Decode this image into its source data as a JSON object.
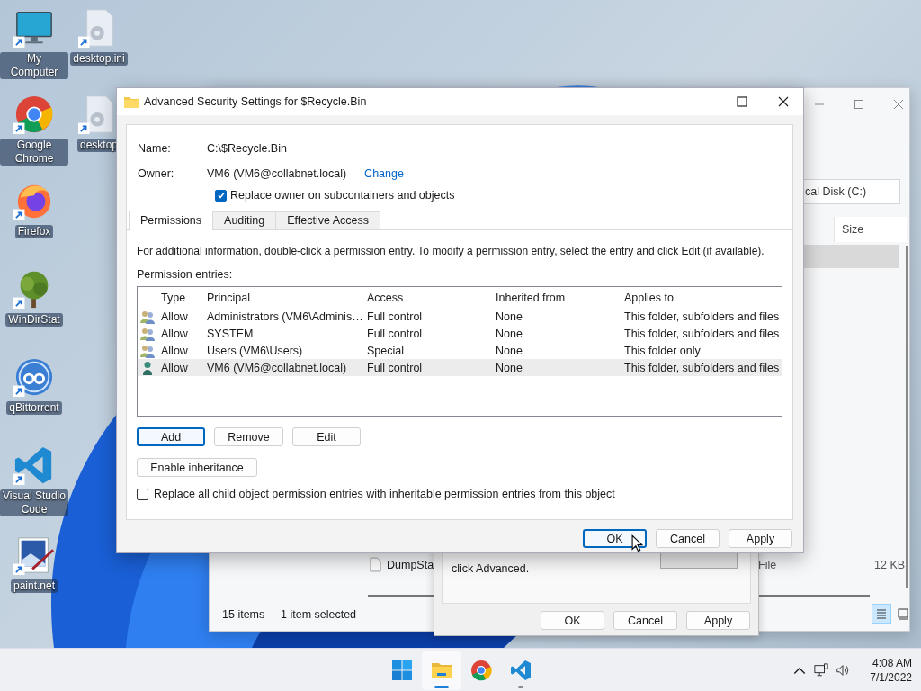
{
  "desktop_icons": [
    {
      "label": "My Computer",
      "kind": "computer"
    },
    {
      "label": "desktop.ini",
      "kind": "settings-file"
    },
    {
      "label": "Google Chrome",
      "kind": "chrome"
    },
    {
      "label": "desktop",
      "kind": "settings-file"
    },
    {
      "label": "Firefox",
      "kind": "firefox"
    },
    {
      "label": "WinDirStat",
      "kind": "tree"
    },
    {
      "label": "qBittorrent",
      "kind": "qb"
    },
    {
      "label": "Visual Studio Code",
      "kind": "vscode"
    },
    {
      "label": "paint.net",
      "kind": "paint"
    }
  ],
  "explorer": {
    "address": "cal Disk (C:)",
    "column": "Size",
    "file": {
      "name": "DumpSta",
      "type": "File",
      "size": "12 KB"
    },
    "status": {
      "items": "15 items",
      "selected": "1 item selected"
    },
    "views": [
      {
        "kind": "details",
        "selected": true
      },
      {
        "kind": "tiles",
        "selected": false
      }
    ]
  },
  "properties": {
    "text": "click Advanced.",
    "buttons": [
      "OK",
      "Cancel",
      "Apply"
    ]
  },
  "dialog": {
    "title": "Advanced Security Settings for $Recycle.Bin",
    "name_label": "Name:",
    "name": "C:\\$Recycle.Bin",
    "owner_label": "Owner:",
    "owner": "VM6 (VM6@collabnet.local)",
    "change_link": "Change",
    "replace_owner": {
      "label": "Replace owner on subcontainers and objects",
      "checked": true
    },
    "tabs": [
      {
        "label": "Permissions",
        "selected": true
      },
      {
        "label": "Auditing",
        "selected": false
      },
      {
        "label": "Effective Access",
        "selected": false
      }
    ],
    "info": "For additional information, double-click a permission entry. To modify a permission entry, select the entry and click Edit (if available).",
    "entries_label": "Permission entries:",
    "columns": [
      "Type",
      "Principal",
      "Access",
      "Inherited from",
      "Applies to"
    ],
    "rows": [
      {
        "kind": "group",
        "type": "Allow",
        "principal": "Administrators (VM6\\Adminis…",
        "access": "Full control",
        "inherited_from": "None",
        "applies_to": "This folder, subfolders and files",
        "selected": false
      },
      {
        "kind": "group",
        "type": "Allow",
        "principal": "SYSTEM",
        "access": "Full control",
        "inherited_from": "None",
        "applies_to": "This folder, subfolders and files",
        "selected": false
      },
      {
        "kind": "group",
        "type": "Allow",
        "principal": "Users (VM6\\Users)",
        "access": "Special",
        "inherited_from": "None",
        "applies_to": "This folder only",
        "selected": false
      },
      {
        "kind": "user",
        "type": "Allow",
        "principal": "VM6 (VM6@collabnet.local)",
        "access": "Full control",
        "inherited_from": "None",
        "applies_to": "This folder, subfolders and files",
        "selected": true
      }
    ],
    "actions": [
      {
        "label": "Add",
        "focused": true
      },
      {
        "label": "Remove",
        "focused": false
      },
      {
        "label": "Edit",
        "focused": false
      }
    ],
    "enable_inheritance": "Enable inheritance",
    "replace_child": {
      "label": "Replace all child object permission entries with inheritable permission entries from this object",
      "checked": false
    },
    "buttons": [
      {
        "label": "OK",
        "focused": true
      },
      {
        "label": "Cancel",
        "focused": false
      },
      {
        "label": "Apply",
        "focused": false
      }
    ]
  },
  "taskbar": {
    "apps": [
      {
        "kind": "start",
        "open": false,
        "selected": false
      },
      {
        "kind": "explorer",
        "open": true,
        "selected": true
      },
      {
        "kind": "chrome",
        "open": false,
        "selected": false
      },
      {
        "kind": "vscode",
        "open": true,
        "selected": false
      }
    ],
    "clock": {
      "time": "4:08 AM",
      "date": "7/1/2022"
    }
  }
}
